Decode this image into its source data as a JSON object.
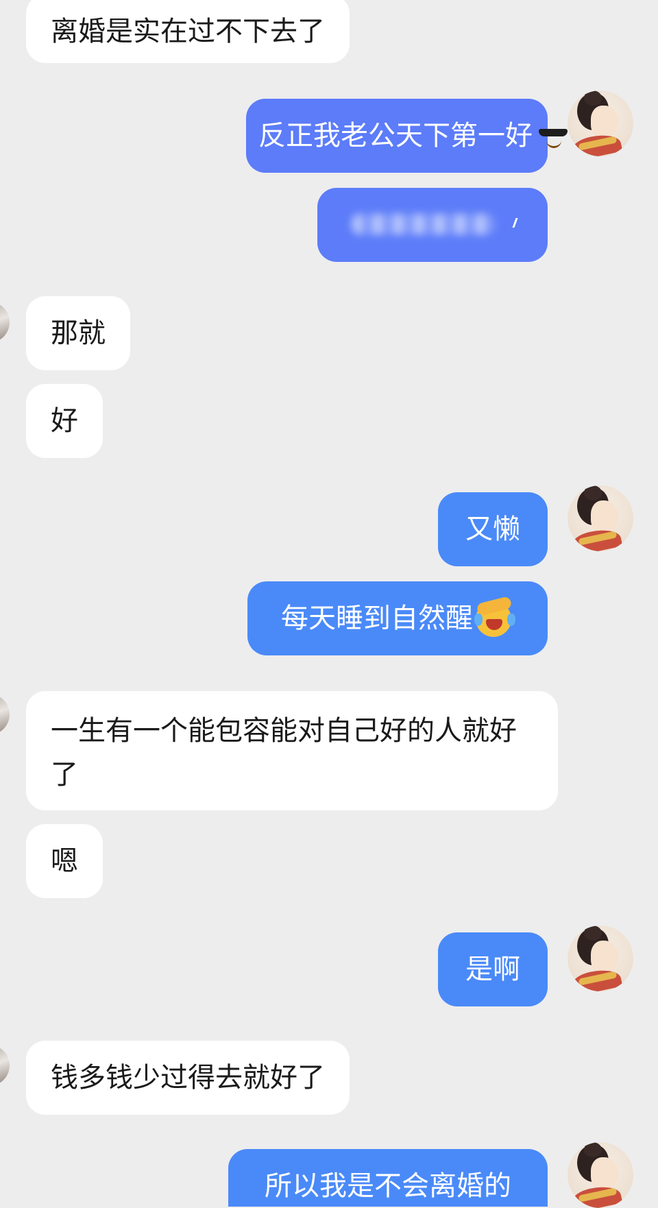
{
  "messages": [
    {
      "side": "in",
      "text": "离婚是实在过不下去了"
    },
    {
      "side": "out",
      "text": "反正我老公天下第一好",
      "emoji": "sunglasses-smile-emoji"
    },
    {
      "side": "out",
      "text": ""
    },
    {
      "side": "in",
      "text": "那就"
    },
    {
      "side": "in",
      "text": "好"
    },
    {
      "side": "out",
      "text": "又懒"
    },
    {
      "side": "out",
      "text": "每天睡到自然醒",
      "emoji": "facepalm-laugh-emoji"
    },
    {
      "side": "in",
      "text": "一生有一个能包容能对自己好的人就好了"
    },
    {
      "side": "in",
      "text": "嗯"
    },
    {
      "side": "out",
      "text": "是啊"
    },
    {
      "side": "in",
      "text": "钱多钱少过得去就好了"
    },
    {
      "side": "out",
      "text": "所以我是不会离婚的"
    }
  ],
  "colors": {
    "background": "#ededee",
    "incoming_bubble": "#ffffff",
    "outgoing_bubble_purple": "#5c7cf9",
    "outgoing_bubble_blue": "#4a8af8"
  },
  "icons": {
    "self_avatar": "woman-portrait-avatar",
    "other_avatar": "partial-avatar"
  }
}
